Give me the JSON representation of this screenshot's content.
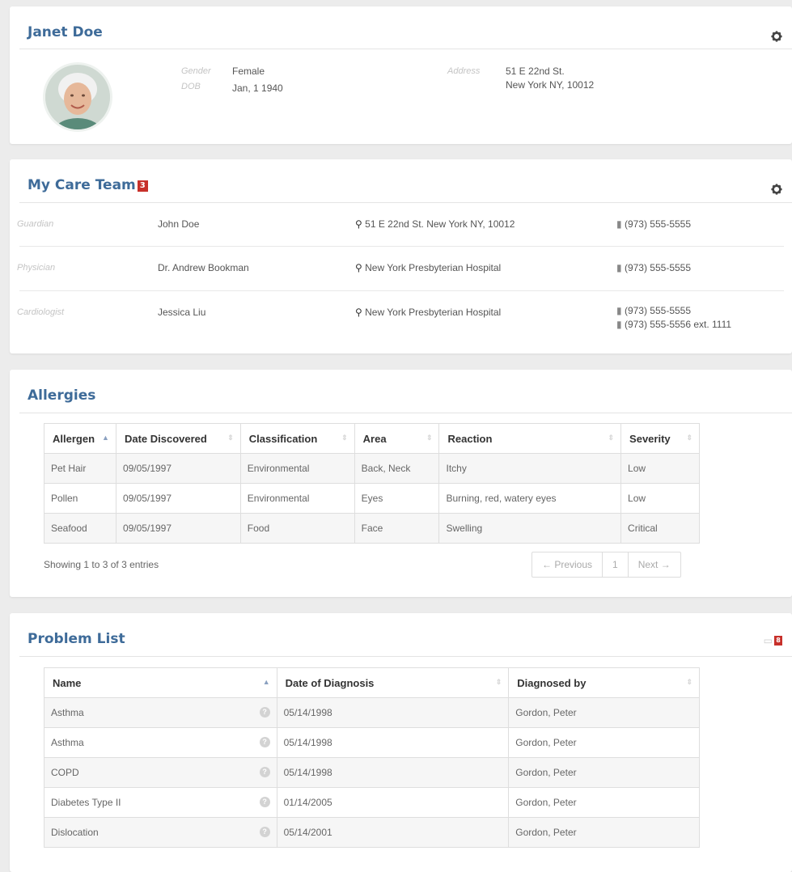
{
  "patient": {
    "name": "Janet Doe",
    "gender_label": "Gender",
    "gender": "Female",
    "dob_label": "DOB",
    "dob": "Jan, 1 1940",
    "address_label": "Address",
    "address_line1": "51 E 22nd St.",
    "address_line2": "New York NY, 10012"
  },
  "care_team": {
    "title": "My Care Team",
    "count": "3",
    "members": [
      {
        "role": "Guardian",
        "name": "John Doe",
        "location": "51 E 22nd St. New York NY, 10012",
        "phones": [
          "(973) 555-5555"
        ]
      },
      {
        "role": "Physician",
        "name": "Dr. Andrew Bookman",
        "location": "New York Presbyterian Hospital",
        "phones": [
          "(973) 555-5555"
        ]
      },
      {
        "role": "Cardiologist",
        "name": "Jessica Liu",
        "location": "New York Presbyterian Hospital",
        "phones": [
          "(973) 555-5555",
          "(973) 555-5556 ext. 1111"
        ]
      }
    ]
  },
  "allergies": {
    "title": "Allergies",
    "columns": [
      "Allergen",
      "Date Discovered",
      "Classification",
      "Area",
      "Reaction",
      "Severity"
    ],
    "rows": [
      [
        "Pet Hair",
        "09/05/1997",
        "Environmental",
        "Back, Neck",
        "Itchy",
        "Low"
      ],
      [
        "Pollen",
        "09/05/1997",
        "Environmental",
        "Eyes",
        "Burning, red, watery eyes",
        "Low"
      ],
      [
        "Seafood",
        "09/05/1997",
        "Food",
        "Face",
        "Swelling",
        "Critical"
      ]
    ],
    "info": "Showing 1 to 3 of 3 entries",
    "pager": {
      "prev": "← Previous",
      "page": "1",
      "next": "Next →"
    }
  },
  "problems": {
    "title": "Problem List",
    "badge": "8",
    "columns": [
      "Name",
      "Date of Diagnosis",
      "Diagnosed by"
    ],
    "rows": [
      [
        "Asthma",
        "05/14/1998",
        "Gordon, Peter"
      ],
      [
        "Asthma",
        "05/14/1998",
        "Gordon, Peter"
      ],
      [
        "COPD",
        "05/14/1998",
        "Gordon, Peter"
      ],
      [
        "Diabetes Type II",
        "01/14/2005",
        "Gordon, Peter"
      ],
      [
        "Dislocation",
        "05/14/2001",
        "Gordon, Peter"
      ]
    ]
  },
  "icons": {
    "gear": "gear-icon",
    "pin": "map-pin-icon",
    "phone": "phone-icon",
    "info": "question-icon",
    "comment": "comment-icon"
  },
  "colors": {
    "title": "#3e6b99",
    "badge": "#c7302a"
  }
}
